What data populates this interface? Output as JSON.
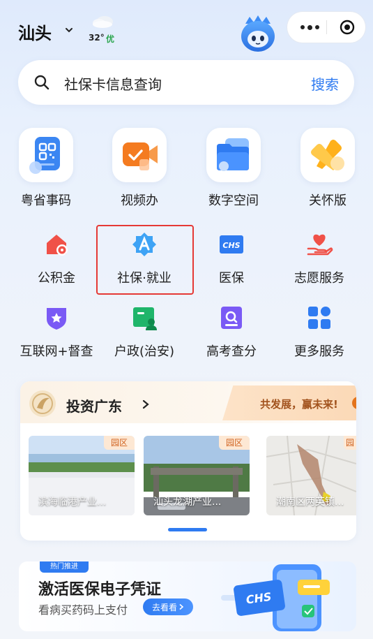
{
  "header": {
    "city": "汕头",
    "temperature": "32°",
    "air_quality": "优"
  },
  "search": {
    "text": "社保卡信息查询",
    "button": "搜索"
  },
  "primary_services": [
    {
      "label": "粤省事码",
      "icon": "qr-code-icon"
    },
    {
      "label": "视频办",
      "icon": "video-camera-icon"
    },
    {
      "label": "数字空间",
      "icon": "folder-stack-icon"
    },
    {
      "label": "关怀版",
      "icon": "care-ribbon-icon"
    }
  ],
  "services": [
    {
      "label": "公积金",
      "icon": "house-fund-icon"
    },
    {
      "label": "社保·就业",
      "icon": "social-security-icon",
      "highlighted": true
    },
    {
      "label": "医保",
      "icon": "chs-icon",
      "icon_text": "CHS"
    },
    {
      "label": "志愿服务",
      "icon": "heart-hand-icon"
    },
    {
      "label": "互联网+督查",
      "icon": "shield-star-icon"
    },
    {
      "label": "户政(治安)",
      "icon": "household-id-icon"
    },
    {
      "label": "高考查分",
      "icon": "exam-search-icon"
    },
    {
      "label": "更多服务",
      "icon": "grid-more-icon"
    }
  ],
  "invest": {
    "title": "投资广东",
    "slogan": "共发展，赢未来!",
    "parks": [
      {
        "tag": "园区",
        "name": "滨海临港产业..."
      },
      {
        "tag": "园区",
        "name": "汕头龙湖产业..."
      },
      {
        "tag": "园区",
        "name": "潮南区两英镇..."
      }
    ]
  },
  "banner": {
    "tag": "热门推进",
    "title": "激活医保电子凭证",
    "subtitle": "看病买药码上支付",
    "button": "去看看",
    "art_text": "CHS"
  },
  "colors": {
    "accent": "#2f7bf1",
    "highlight_border": "#e53935",
    "aqi_good": "#2ca64f",
    "slogan": "#a2531e"
  }
}
